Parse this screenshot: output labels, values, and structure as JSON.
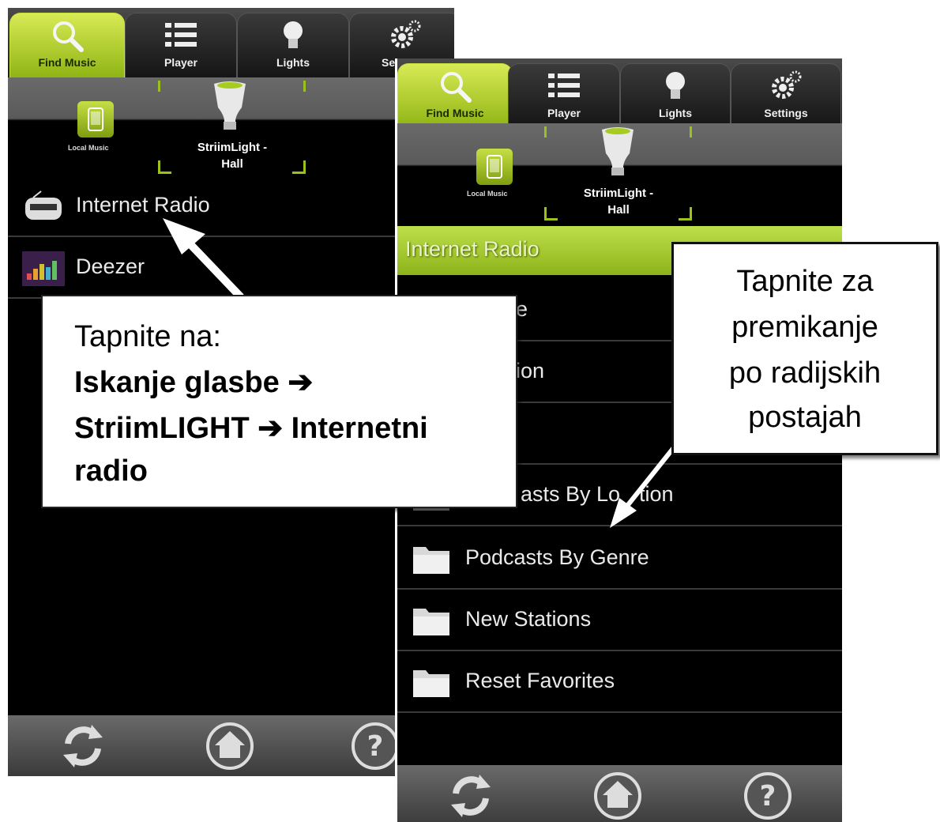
{
  "tabs": [
    {
      "label": "Find Music",
      "icon": "search-icon",
      "active": true
    },
    {
      "label": "Player",
      "icon": "list-icon",
      "active": false
    },
    {
      "label": "Lights",
      "icon": "bulb-icon",
      "active": false
    },
    {
      "label": "Settings",
      "icon": "gear-icon",
      "active": false
    }
  ],
  "source": {
    "local_label": "Local Music",
    "device_label_line1": "StriimLight -",
    "device_label_line2": "Hall"
  },
  "screen1": {
    "tab3_visible_label": "Se",
    "items": [
      {
        "label": "Internet Radio",
        "icon": "radio-icon"
      },
      {
        "label": "Deezer",
        "icon": "deezer-icon"
      }
    ]
  },
  "screen2": {
    "header": "Internet Radio",
    "partial_items": [
      "e",
      "ion",
      "",
      "asts By Lo",
      "tion"
    ],
    "items": [
      {
        "label": "Podcasts By Genre",
        "icon": "folder-icon"
      },
      {
        "label": "New Stations",
        "icon": "folder-icon"
      },
      {
        "label": "Reset Favorites",
        "icon": "folder-icon"
      }
    ]
  },
  "bottom_bar": [
    "refresh-icon",
    "home-icon",
    "help-icon"
  ],
  "callout1": {
    "line1": "Tapnite na:",
    "line2": "Iskanje glasbe ➔",
    "line3": "StriimLIGHT ➔ Internetni",
    "line4": "radio"
  },
  "callout2": {
    "line1": "Tapnite za",
    "line2": "premikanje",
    "line3": "po radijskih",
    "line4": "postajah"
  },
  "colors": {
    "accent": "#a6cc22",
    "background": "#000000",
    "tab_active": "#c6df45"
  }
}
